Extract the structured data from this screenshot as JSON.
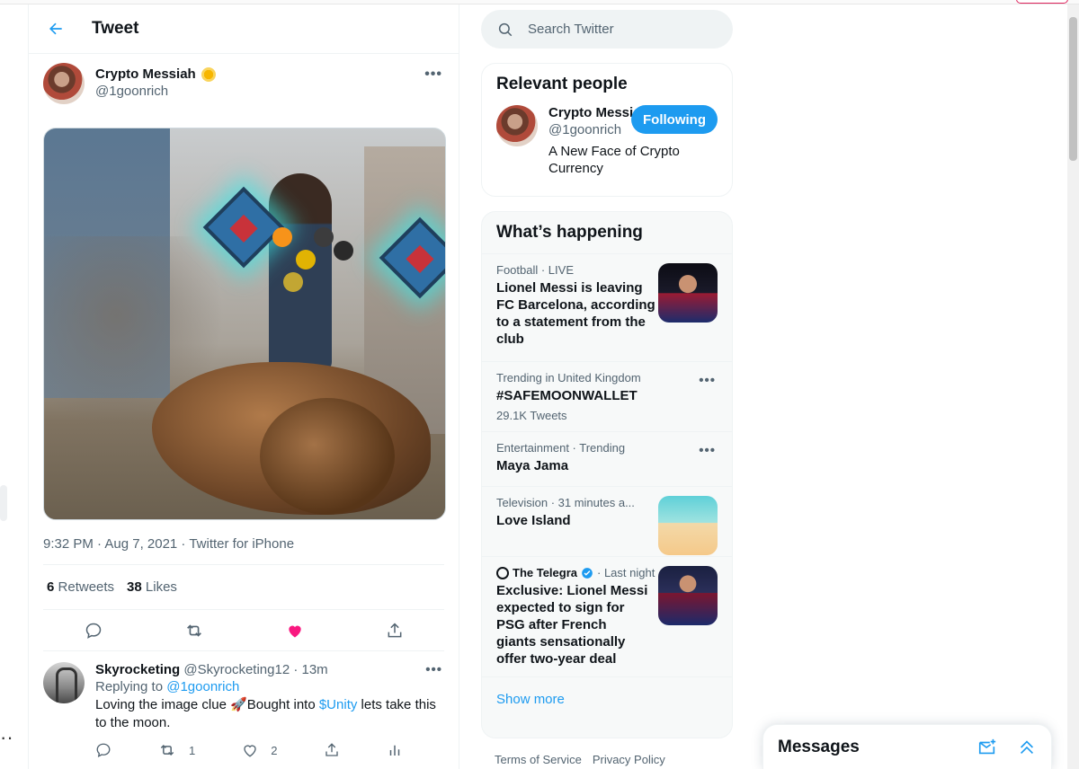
{
  "header": {
    "title": "Tweet"
  },
  "tweet": {
    "author_name": "Crypto Messiah",
    "author_handle": "@1goonrich",
    "timestamp": "9:32 PM · Aug 7, 2021 · Twitter for iPhone",
    "retweets_count": "6",
    "retweets_label": "Retweets",
    "likes_count": "38",
    "likes_label": "Likes"
  },
  "reply": {
    "name": "Skyrocketing",
    "meta": "@Skyrocketing12 · 13m",
    "replying_prefix": "Replying to",
    "replying_handle": "@1goonrich",
    "text_before": "Loving the image clue 🚀Bought into ",
    "cashtag": "$Unity",
    "text_after": " lets take this to the moon.",
    "retweets": "1",
    "likes": "2"
  },
  "search": {
    "placeholder": "Search Twitter"
  },
  "relevant": {
    "title": "Relevant people",
    "name": "Crypto Messiah",
    "handle": "@1goonrich",
    "button": "Following",
    "bio": "A New Face of Crypto Currency"
  },
  "happening": {
    "title": "What’s happening",
    "trends": [
      {
        "context": "Football · LIVE",
        "title": "Lionel Messi is leaving FC Barcelona, according to a statement from the club",
        "count": ""
      },
      {
        "context": "Trending in United Kingdom",
        "title": "#SAFEMOONWALLET",
        "count": "29.1K Tweets"
      },
      {
        "context": "Entertainment · Trending",
        "title": "Maya Jama",
        "count": ""
      },
      {
        "context": "Television · 31 minutes a...",
        "title": "Love Island",
        "count": ""
      },
      {
        "context_source": "The Telegra",
        "context_time": "· Last night",
        "title": "Exclusive: Lionel Messi expected to sign for PSG after French giants sensationally offer two-year deal",
        "count": ""
      }
    ],
    "show_more": "Show more"
  },
  "footer": {
    "terms": "Terms of Service",
    "privacy": "Privacy Policy"
  },
  "messages": {
    "title": "Messages"
  },
  "colors": {
    "accent": "#1d9bf0",
    "like": "#f91880",
    "text_secondary": "#536471"
  },
  "icons": [
    "back-arrow-icon",
    "more-icon",
    "reply-icon",
    "retweet-icon",
    "heart-icon",
    "share-icon",
    "search-icon",
    "analytics-icon",
    "new-message-icon",
    "chevron-up-icon",
    "verified-icon",
    "sun-emoji-icon"
  ]
}
